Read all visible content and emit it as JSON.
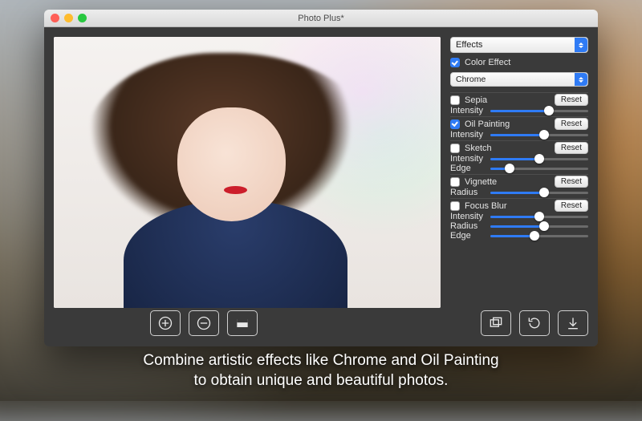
{
  "window": {
    "title": "Photo Plus*"
  },
  "panel": {
    "mainDropdown": "Effects",
    "colorEffect": {
      "label": "Color Effect",
      "checked": true,
      "selected": "Chrome"
    },
    "resetLabel": "Reset",
    "sepia": {
      "label": "Sepia",
      "checked": false,
      "sliders": [
        {
          "label": "Intensity",
          "value": 60
        }
      ]
    },
    "oil": {
      "label": "Oil Painting",
      "checked": true,
      "sliders": [
        {
          "label": "Intensity",
          "value": 55
        }
      ]
    },
    "sketch": {
      "label": "Sketch",
      "checked": false,
      "sliders": [
        {
          "label": "Intensity",
          "value": 50
        },
        {
          "label": "Edge",
          "value": 20
        }
      ]
    },
    "vignette": {
      "label": "Vignette",
      "checked": false,
      "sliders": [
        {
          "label": "Radius",
          "value": 55
        }
      ]
    },
    "focusBlur": {
      "label": "Focus Blur",
      "checked": false,
      "sliders": [
        {
          "label": "Intensity",
          "value": 50
        },
        {
          "label": "Radius",
          "value": 55
        },
        {
          "label": "Edge",
          "value": 45
        }
      ]
    }
  },
  "toolbar": {
    "zoomIn": "zoom-in",
    "zoomOut": "zoom-out",
    "fit": "fit-width",
    "compare": "compare",
    "rotate": "rotate",
    "export": "export"
  },
  "colors": {
    "accent": "#2f7bf5"
  },
  "caption": {
    "line1": "Combine artistic effects like Chrome and Oil Painting",
    "line2": "to obtain unique and beautiful photos."
  }
}
